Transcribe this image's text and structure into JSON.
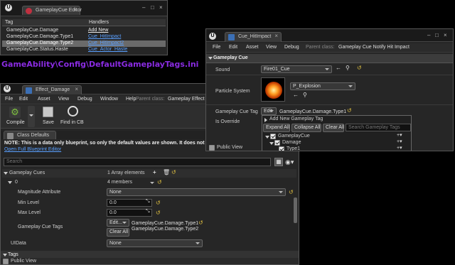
{
  "overlay_caption": "GameAbility\\Config\\DefaultGameplayTags.ini",
  "tag_editor": {
    "tab_title": "GameplayCue Editor",
    "col_tag": "Tag",
    "col_handlers": "Handlers",
    "rows": [
      {
        "tag": "GameplayCue.Damage",
        "handler": "Add New"
      },
      {
        "tag": "GameplayCue.Damage.Type1",
        "handler": "Cue_HitImpact"
      },
      {
        "tag": "GameplayCue.Damage.Type2",
        "handler": "Cue_HitImpact2"
      },
      {
        "tag": "GameplayCue.Status.Haste",
        "handler": "Cue_Actor_Haste"
      }
    ]
  },
  "hit_impact": {
    "tab_title": "Cue_HitImpact",
    "menu": [
      "File",
      "Edit",
      "Asset",
      "View",
      "Debug"
    ],
    "parent_class_label": "Parent class:",
    "parent_class_value": "Gameplay Cue Notify Hit Impact",
    "section_title": "Gameplay Cue",
    "sound_label": "Sound",
    "sound_value": "Fire01_Cue",
    "particle_label": "Particle System",
    "particle_value": "P_Explosion",
    "cue_tag_label": "Gameplay Cue Tag",
    "cue_tag_button": "Edit",
    "cue_tag_value": "GameplayCue.Damage.Type1",
    "is_override_label": "Is Override",
    "public_view": "Public View",
    "popup": {
      "add_new": "Add New Gameplay Tag",
      "expand_all": "Expand All",
      "collapse_all": "Collapse All",
      "clear_all": "Clear All",
      "search_placeholder": "Search Gameplay Tags",
      "tree": [
        {
          "label": "GameplayCue",
          "checked": true
        },
        {
          "label": "Damage",
          "checked": true
        },
        {
          "label": "Type1",
          "checked": true
        }
      ]
    }
  },
  "effect_damage": {
    "tab_title": "Effect_Damage",
    "menu": [
      "File",
      "Edit",
      "Asset",
      "View",
      "Debug",
      "Window",
      "Help"
    ],
    "parent_class_label": "Parent class:",
    "parent_class_value": "Gameplay Effect",
    "toolbar": {
      "compile": "Compile",
      "save": "Save",
      "find": "Find in CB"
    },
    "class_defaults_tab": "Class Defaults",
    "note": "NOTE: This is a data only blueprint, so only the default values are shown.  It does not have an",
    "open_full": "Open Full Blueprint Editor",
    "search_placeholder": "Search",
    "gameplay_cues_label": "Gameplay Cues",
    "gameplay_cues_value": "1 Array elements",
    "index_label": "0",
    "index_value": "4 members",
    "magnitude_label": "Magnitude Attribute",
    "magnitude_value": "None",
    "min_level_label": "Min Level",
    "min_level_value": "0.0",
    "max_level_label": "Max Level",
    "max_level_value": "0.0",
    "cue_tags_label": "Gameplay Cue Tags",
    "cue_tags_edit": "Edit...",
    "cue_tags_clear": "Clear All",
    "cue_tags_values": [
      "GameplayCue.Damage.Type1",
      "GameplayCue.Damage.Type2"
    ],
    "uidata_label": "UIData",
    "uidata_value": "None",
    "tags_label": "Tags",
    "public_view": "Public View"
  }
}
